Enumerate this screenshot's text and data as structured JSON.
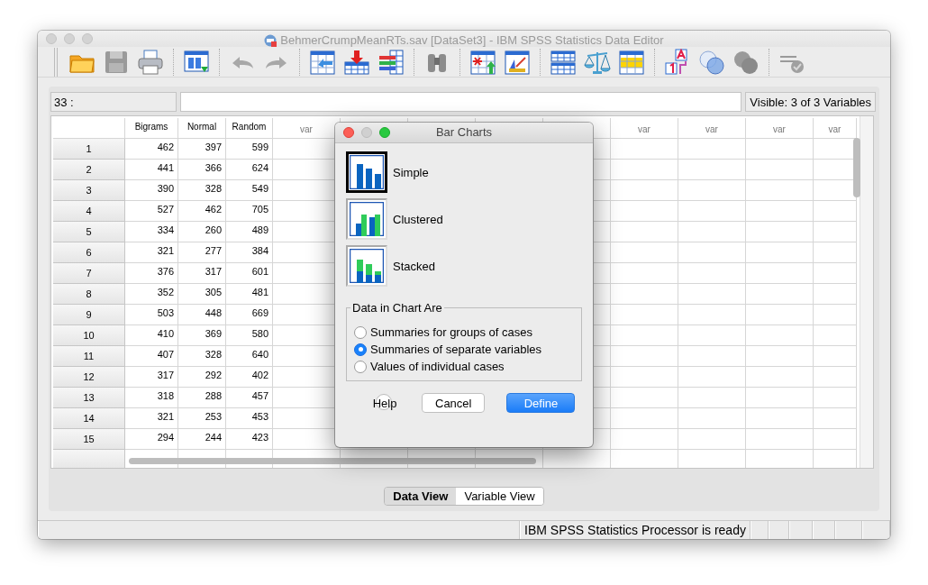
{
  "window": {
    "title": "BehmerCrumpMeanRTs.sav [DataSet3] - IBM SPSS Statistics Data Editor"
  },
  "cell_editor": {
    "cell_reference": "33 :",
    "visible_info": "Visible: 3 of 3 Variables"
  },
  "table": {
    "columns": [
      {
        "label": "Bigrams",
        "kind": "variable"
      },
      {
        "label": "Normal",
        "kind": "variable"
      },
      {
        "label": "Random",
        "kind": "variable"
      },
      {
        "label": "var",
        "kind": "empty"
      },
      {
        "kind": "covered"
      },
      {
        "kind": "covered"
      },
      {
        "kind": "covered"
      },
      {
        "kind": "covered"
      },
      {
        "label": "var",
        "kind": "empty"
      },
      {
        "label": "var",
        "kind": "empty"
      },
      {
        "label": "var",
        "kind": "empty"
      },
      {
        "label": "var",
        "kind": "empty"
      }
    ],
    "rows": [
      {
        "case": "1",
        "values": [
          "462",
          "397",
          "599"
        ]
      },
      {
        "case": "2",
        "values": [
          "441",
          "366",
          "624"
        ]
      },
      {
        "case": "3",
        "values": [
          "390",
          "328",
          "549"
        ]
      },
      {
        "case": "4",
        "values": [
          "527",
          "462",
          "705"
        ]
      },
      {
        "case": "5",
        "values": [
          "334",
          "260",
          "489"
        ]
      },
      {
        "case": "6",
        "values": [
          "321",
          "277",
          "384"
        ]
      },
      {
        "case": "7",
        "values": [
          "376",
          "317",
          "601"
        ]
      },
      {
        "case": "8",
        "values": [
          "352",
          "305",
          "481"
        ]
      },
      {
        "case": "9",
        "values": [
          "503",
          "448",
          "669"
        ]
      },
      {
        "case": "10",
        "values": [
          "410",
          "369",
          "580"
        ]
      },
      {
        "case": "11",
        "values": [
          "407",
          "328",
          "640"
        ]
      },
      {
        "case": "12",
        "values": [
          "317",
          "292",
          "402"
        ]
      },
      {
        "case": "13",
        "values": [
          "318",
          "288",
          "457"
        ]
      },
      {
        "case": "14",
        "values": [
          "321",
          "253",
          "453"
        ]
      },
      {
        "case": "15",
        "values": [
          "294",
          "244",
          "423"
        ]
      }
    ]
  },
  "view_tabs": [
    {
      "label": "Data View",
      "selected": true
    },
    {
      "label": "Variable View",
      "selected": false
    }
  ],
  "status_bar": {
    "message": "IBM SPSS Statistics Processor is ready"
  },
  "dialog": {
    "title": "Bar Charts",
    "chart_types": [
      {
        "label": "Simple",
        "kind": "simple",
        "selected": true
      },
      {
        "label": "Clustered",
        "kind": "clustered",
        "selected": false
      },
      {
        "label": "Stacked",
        "kind": "stacked",
        "selected": false
      }
    ],
    "group": {
      "title": "Data in Chart Are",
      "options": [
        {
          "label": "Summaries for groups of cases",
          "selected": false
        },
        {
          "label": "Summaries of separate variables",
          "selected": true
        },
        {
          "label": "Values of individual cases",
          "selected": false
        }
      ]
    },
    "buttons": [
      {
        "label": "Help",
        "kind": "help"
      },
      {
        "label": "Cancel",
        "kind": "plain"
      },
      {
        "label": "Define",
        "kind": "default"
      }
    ]
  }
}
